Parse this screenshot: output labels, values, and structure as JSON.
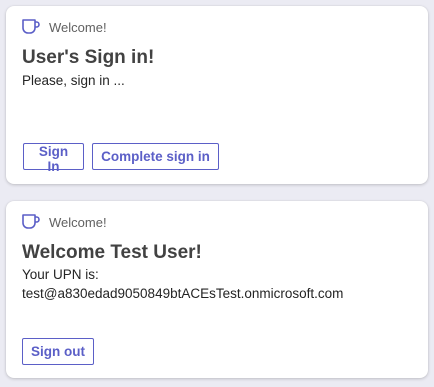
{
  "cards": [
    {
      "header": "Welcome!",
      "icon": "coffee-cup-icon",
      "title": "User's Sign in!",
      "lines": [
        "Please, sign in ..."
      ],
      "buttons": [
        "Sign In",
        "Complete sign in"
      ]
    },
    {
      "header": "Welcome!",
      "icon": "coffee-cup-icon",
      "title": "Welcome Test User!",
      "lines": [
        "Your UPN is:",
        "test@a830edad9050849btACEsTest.onmicrosoft.com"
      ],
      "buttons": [
        "Sign out"
      ]
    }
  ],
  "colors": {
    "accent": "#5b5fc7",
    "background": "#ebebf3",
    "card": "#ffffff"
  }
}
